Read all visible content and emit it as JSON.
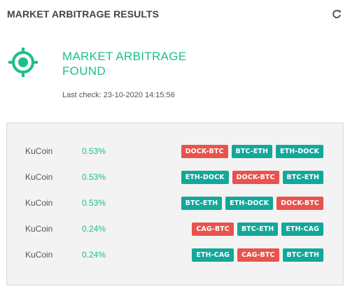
{
  "header": {
    "title": "MARKET ARBITRAGE RESULTS",
    "refresh_icon": "refresh-icon"
  },
  "status": {
    "title": "MARKET ARBITRAGE FOUND",
    "last_check": "Last check: 23-10-2020 14:15:56",
    "icon": "target-icon"
  },
  "colors": {
    "accent": "#1cbf8a",
    "sell": "#e8534d",
    "buy": "#12a89a"
  },
  "results": [
    {
      "exchange": "KuCoin",
      "percent": "0.53%",
      "pairs": [
        {
          "label": "DOCK-BTC",
          "kind": "sell"
        },
        {
          "label": "BTC-ETH",
          "kind": "buy"
        },
        {
          "label": "ETH-DOCK",
          "kind": "buy"
        }
      ]
    },
    {
      "exchange": "KuCoin",
      "percent": "0.53%",
      "pairs": [
        {
          "label": "ETH-DOCK",
          "kind": "buy"
        },
        {
          "label": "DOCK-BTC",
          "kind": "sell"
        },
        {
          "label": "BTC-ETH",
          "kind": "buy"
        }
      ]
    },
    {
      "exchange": "KuCoin",
      "percent": "0.53%",
      "pairs": [
        {
          "label": "BTC-ETH",
          "kind": "buy"
        },
        {
          "label": "ETH-DOCK",
          "kind": "buy"
        },
        {
          "label": "DOCK-BTC",
          "kind": "sell"
        }
      ]
    },
    {
      "exchange": "KuCoin",
      "percent": "0.24%",
      "pairs": [
        {
          "label": "CAG-BTC",
          "kind": "sell"
        },
        {
          "label": "BTC-ETH",
          "kind": "buy"
        },
        {
          "label": "ETH-CAG",
          "kind": "buy"
        }
      ]
    },
    {
      "exchange": "KuCoin",
      "percent": "0.24%",
      "pairs": [
        {
          "label": "ETH-CAG",
          "kind": "buy"
        },
        {
          "label": "CAG-BTC",
          "kind": "sell"
        },
        {
          "label": "BTC-ETH",
          "kind": "buy"
        }
      ]
    }
  ]
}
